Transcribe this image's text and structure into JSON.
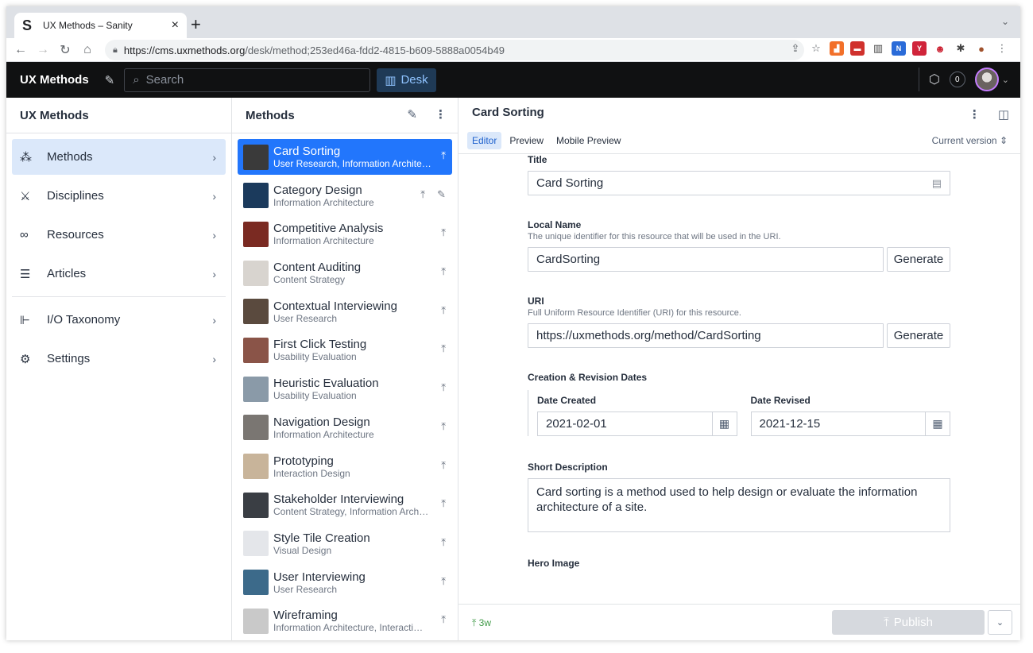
{
  "browser": {
    "tab_title": "UX Methods – Sanity",
    "favicon": "S",
    "url_host": "https://cms.uxmethods.org",
    "url_path": "/desk/method;253ed46a-fdd2-4815-b609-5888a0054b49"
  },
  "topnav": {
    "brand": "UX Methods",
    "search_placeholder": "Search",
    "desk_label": "Desk",
    "notification_count": "0"
  },
  "root_pane": {
    "title": "UX Methods",
    "items": [
      {
        "label": "Methods",
        "icon": "methods-icon"
      },
      {
        "label": "Disciplines",
        "icon": "compass-icon"
      },
      {
        "label": "Resources",
        "icon": "link-icon"
      },
      {
        "label": "Articles",
        "icon": "document-icon"
      },
      {
        "label": "I/O Taxonomy",
        "icon": "tree-icon"
      },
      {
        "label": "Settings",
        "icon": "gear-icon"
      }
    ]
  },
  "list_pane": {
    "title": "Methods",
    "items": [
      {
        "title": "Card Sorting",
        "subtitle": "User Research, Information Archite…",
        "thumb_color": "#3a3a3a"
      },
      {
        "title": "Category Design",
        "subtitle": "Information Architecture",
        "thumb_color": "#1b3a5c"
      },
      {
        "title": "Competitive Analysis",
        "subtitle": "Information Architecture",
        "thumb_color": "#7a2a22"
      },
      {
        "title": "Content Auditing",
        "subtitle": "Content Strategy",
        "thumb_color": "#d8d4cf"
      },
      {
        "title": "Contextual Interviewing",
        "subtitle": "User Research",
        "thumb_color": "#5a4a3e"
      },
      {
        "title": "First Click Testing",
        "subtitle": "Usability Evaluation",
        "thumb_color": "#8a5448"
      },
      {
        "title": "Heuristic Evaluation",
        "subtitle": "Usability Evaluation",
        "thumb_color": "#8a9aa8"
      },
      {
        "title": "Navigation Design",
        "subtitle": "Information Architecture",
        "thumb_color": "#7a7672"
      },
      {
        "title": "Prototyping",
        "subtitle": "Interaction Design",
        "thumb_color": "#c8b49a"
      },
      {
        "title": "Stakeholder Interviewing",
        "subtitle": "Content Strategy, Information Arch…",
        "thumb_color": "#3a3e44"
      },
      {
        "title": "Style Tile Creation",
        "subtitle": "Visual Design",
        "thumb_color": "#e4e6ea"
      },
      {
        "title": "User Interviewing",
        "subtitle": "User Research",
        "thumb_color": "#3c6a8a"
      },
      {
        "title": "Wireframing",
        "subtitle": "Information Architecture, Interacti…",
        "thumb_color": "#c9c9c9"
      }
    ]
  },
  "doc_pane": {
    "title": "Card Sorting",
    "tabs": [
      "Editor",
      "Preview",
      "Mobile Preview"
    ],
    "version": "Current version",
    "fields": {
      "title_label": "Title",
      "title_value": "Card Sorting",
      "local_name_label": "Local Name",
      "local_name_desc": "The unique identifier for this resource that will be used in the URI.",
      "local_name_value": "CardSorting",
      "uri_label": "URI",
      "uri_desc": "Full Uniform Resource Identifier (URI) for this resource.",
      "uri_value": "https://uxmethods.org/method/CardSorting",
      "generate_label": "Generate",
      "dates_label": "Creation & Revision Dates",
      "date_created_label": "Date Created",
      "date_created_value": "2021-02-01",
      "date_revised_label": "Date Revised",
      "date_revised_value": "2021-12-15",
      "short_desc_label": "Short Description",
      "short_desc_value": "Card sorting is a method used to help design or evaluate the information architecture of a site.",
      "hero_label": "Hero Image"
    },
    "footer": {
      "ago": "3w",
      "publish_label": "Publish"
    }
  },
  "colors": {
    "accent": "#2276fc",
    "selected_bg": "#dbe8fa",
    "topbar": "#101112"
  }
}
